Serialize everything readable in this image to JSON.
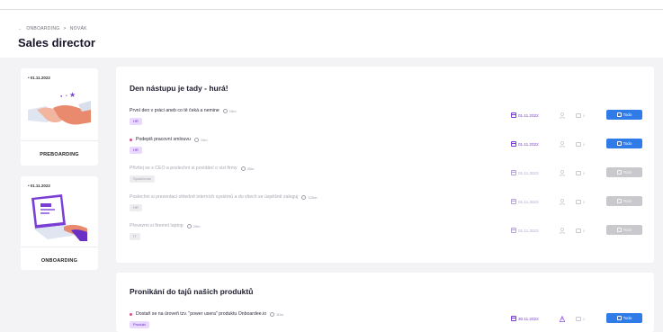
{
  "breadcrumb": {
    "back_icon": "arrow-left-icon",
    "first": "ONBOARDING",
    "separator": ">",
    "second": "NOVÁK"
  },
  "page_title": "Sales director",
  "phases": [
    {
      "date": "01.11.2022",
      "label": "PREBOARDING",
      "illustration": "handshake-illustration"
    },
    {
      "date": "01.11.2022",
      "label": "ONBOARDING",
      "illustration": "laptop-illustration"
    }
  ],
  "sections": [
    {
      "title": "Den nástupu je tady - hurá!",
      "tasks": [
        {
          "title": "První den v práci aneb co tě čeká a nemine",
          "duration": "15m",
          "tag": "HR",
          "date": "01.11.2022",
          "comments": "0",
          "button": "Todo",
          "active": true,
          "dot": false
        },
        {
          "title": "Podepiš pracovní smlouvu",
          "duration": "10m",
          "tag": "HR",
          "date": "01.11.2022",
          "comments": "0",
          "button": "Todo",
          "active": true,
          "dot": true
        },
        {
          "title": "Přivítej se s CEO a poslechni si povídání o vizi firmy",
          "duration": "30m",
          "tag": "Společnost",
          "date": "01.11.2022",
          "comments": "0",
          "button": "Todo",
          "active": false,
          "dot": false
        },
        {
          "title": "Poslechni si prezentaci ohledně interních systémů a do všech se úspěšně zaloguj",
          "duration": "120m",
          "tag": "HR",
          "date": "01.11.2022",
          "comments": "0",
          "button": "Todo",
          "active": false,
          "dot": false
        },
        {
          "title": "Převezmi si firemní laptop",
          "duration": "20m",
          "tag": "IT",
          "date": "01.11.2022",
          "comments": "0",
          "button": "Todo",
          "active": false,
          "dot": false
        }
      ]
    },
    {
      "title": "Pronikání do tajů našich produktů",
      "tasks": [
        {
          "title": "Dostaň se na úroveň tzv. \"power usera\" produktu Onboardee.io",
          "duration": "30m",
          "tag": "Produkt",
          "date": "30.11.2022",
          "comments": "0",
          "button": "Todo",
          "active": true,
          "dot": true
        }
      ]
    }
  ],
  "colors": {
    "accent": "#2f7be8",
    "purple": "#7d3bd8",
    "tag_purple_bg": "#ead9ff",
    "background": "#f3f3f6",
    "dot": "#d94c8d"
  }
}
